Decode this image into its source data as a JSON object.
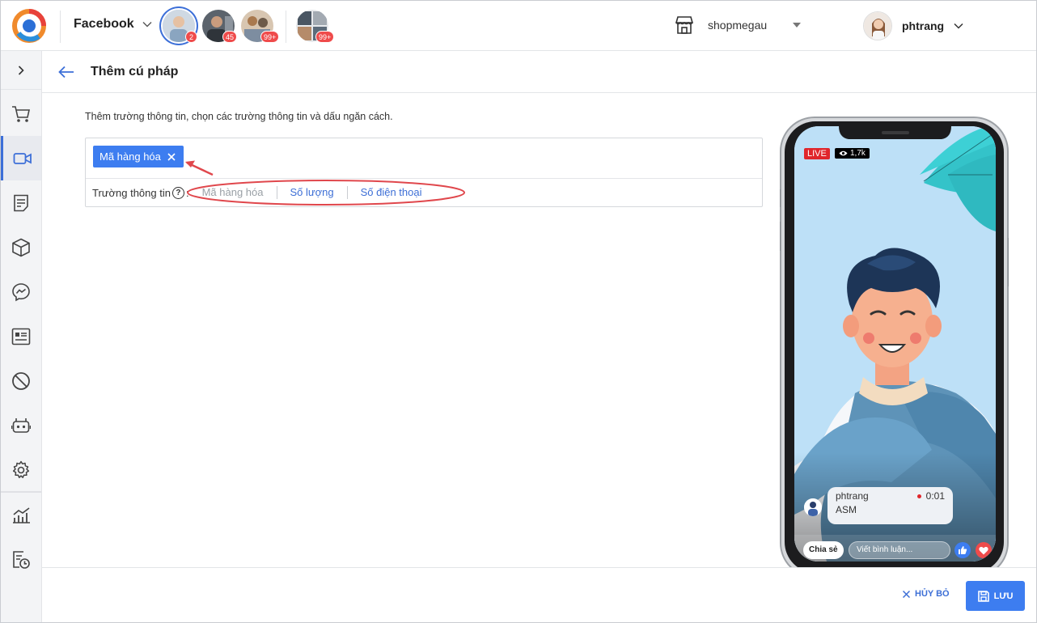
{
  "topbar": {
    "channel_label": "Facebook",
    "pages": [
      {
        "badge": "2"
      },
      {
        "badge": "45"
      },
      {
        "badge": "99+"
      },
      {
        "badge": "99+"
      }
    ],
    "shop_name": "shopmegau",
    "user_name": "phtrang"
  },
  "header": {
    "title": "Thêm cú pháp"
  },
  "form": {
    "instruction": "Thêm trường thông tin, chọn các trường thông tin và dấu ngăn cách.",
    "selected_tag": "Mã hàng hóa",
    "field_label": "Trường thông tin",
    "field_options": [
      {
        "label": "Mã hàng hóa",
        "disabled": true
      },
      {
        "label": "Số lượng",
        "disabled": false
      },
      {
        "label": "Số điện thoại",
        "disabled": false
      }
    ]
  },
  "footer": {
    "cancel_label": "HỦY BỎ",
    "save_label": "LƯU"
  },
  "preview": {
    "live_label": "LIVE",
    "views": "1,7k",
    "comment_user": "phtrang",
    "comment_time": "0:01",
    "comment_text": "ASM",
    "share_label": "Chia sẻ",
    "comment_placeholder": "Viết bình luận..."
  },
  "colors": {
    "accent": "#3d7df0",
    "link": "#3d6fd6",
    "annotation": "#e0474c",
    "live": "#e0262b"
  }
}
